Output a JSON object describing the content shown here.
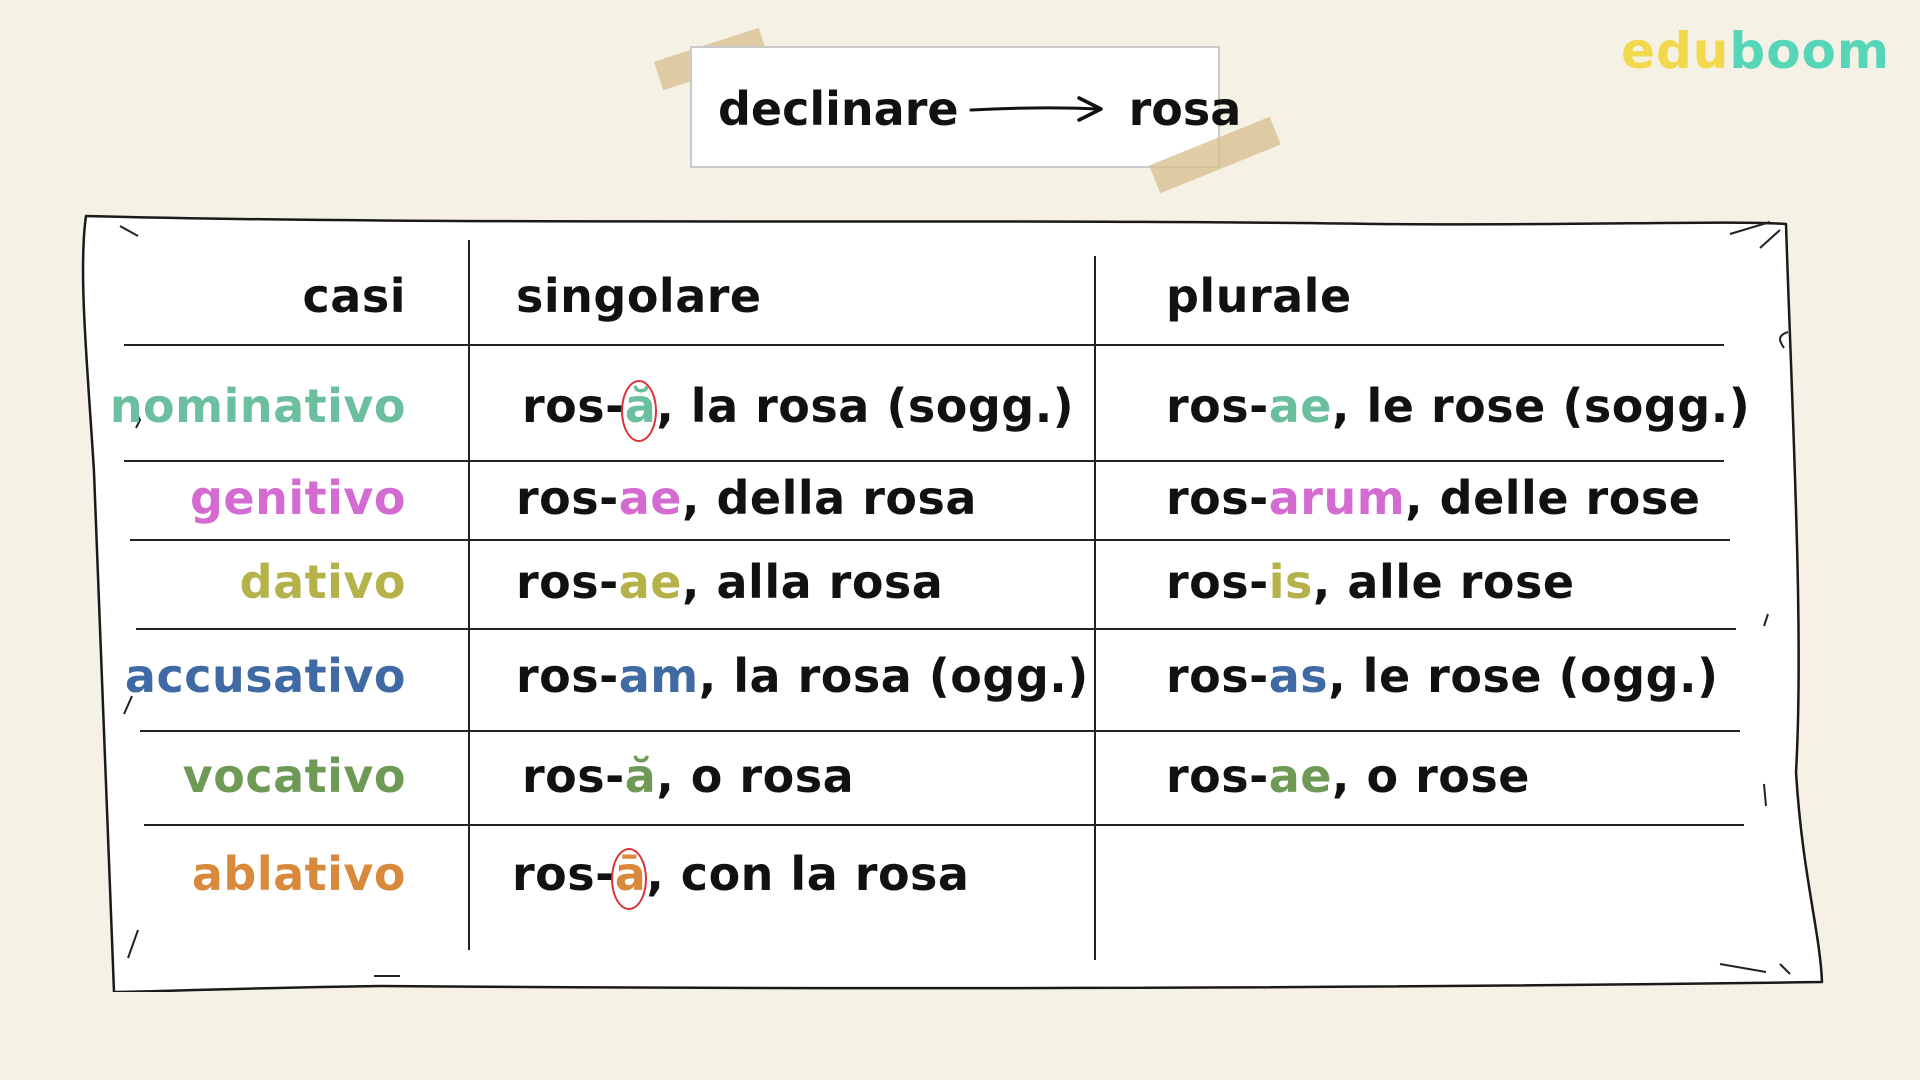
{
  "logo": {
    "part1": "edu",
    "part2": "boom",
    "color1": "#f2d84b",
    "color2": "#56d6b8"
  },
  "title": {
    "left": "declinare",
    "right": "rosa"
  },
  "table": {
    "headers": {
      "cases": "casi",
      "singular": "singolare",
      "plural": "plurale"
    },
    "rows": [
      {
        "case": "nominativo",
        "color": "#6cbf9e",
        "sg_stem": "ros-",
        "sg_ending": "ă",
        "sg_rest": ", la rosa (sogg.)",
        "sg_circled": true,
        "pl_stem": "ros-",
        "pl_ending": "ae",
        "pl_rest": ", le rose (sogg.)"
      },
      {
        "case": "genitivo",
        "color": "#d46bd1",
        "sg_stem": "ros-",
        "sg_ending": "ae",
        "sg_rest": ", della rosa",
        "sg_circled": false,
        "pl_stem": "ros-",
        "pl_ending": "arum",
        "pl_rest": ", delle rose"
      },
      {
        "case": "dativo",
        "color": "#b5b24a",
        "sg_stem": "ros-",
        "sg_ending": "ae",
        "sg_rest": ", alla rosa",
        "sg_circled": false,
        "pl_stem": "ros-",
        "pl_ending": "is",
        "pl_rest": ", alle rose"
      },
      {
        "case": "accusativo",
        "color": "#3f6aa3",
        "sg_stem": "ros-",
        "sg_ending": "am",
        "sg_rest": ", la rosa (ogg.)",
        "sg_circled": false,
        "pl_stem": "ros-",
        "pl_ending": "as",
        "pl_rest": ", le rose (ogg.)"
      },
      {
        "case": "vocativo",
        "color": "#6f9a56",
        "sg_stem": "ros-",
        "sg_ending": "ă",
        "sg_rest": ", o rosa",
        "sg_circled": false,
        "pl_stem": "ros-",
        "pl_ending": "ae",
        "pl_rest": ", o rose"
      },
      {
        "case": "ablativo",
        "color": "#d9893c",
        "sg_stem": "ros-",
        "sg_ending": "ā",
        "sg_rest": ", con la rosa",
        "sg_circled": true,
        "pl_stem": "",
        "pl_ending": "",
        "pl_rest": ""
      }
    ]
  }
}
